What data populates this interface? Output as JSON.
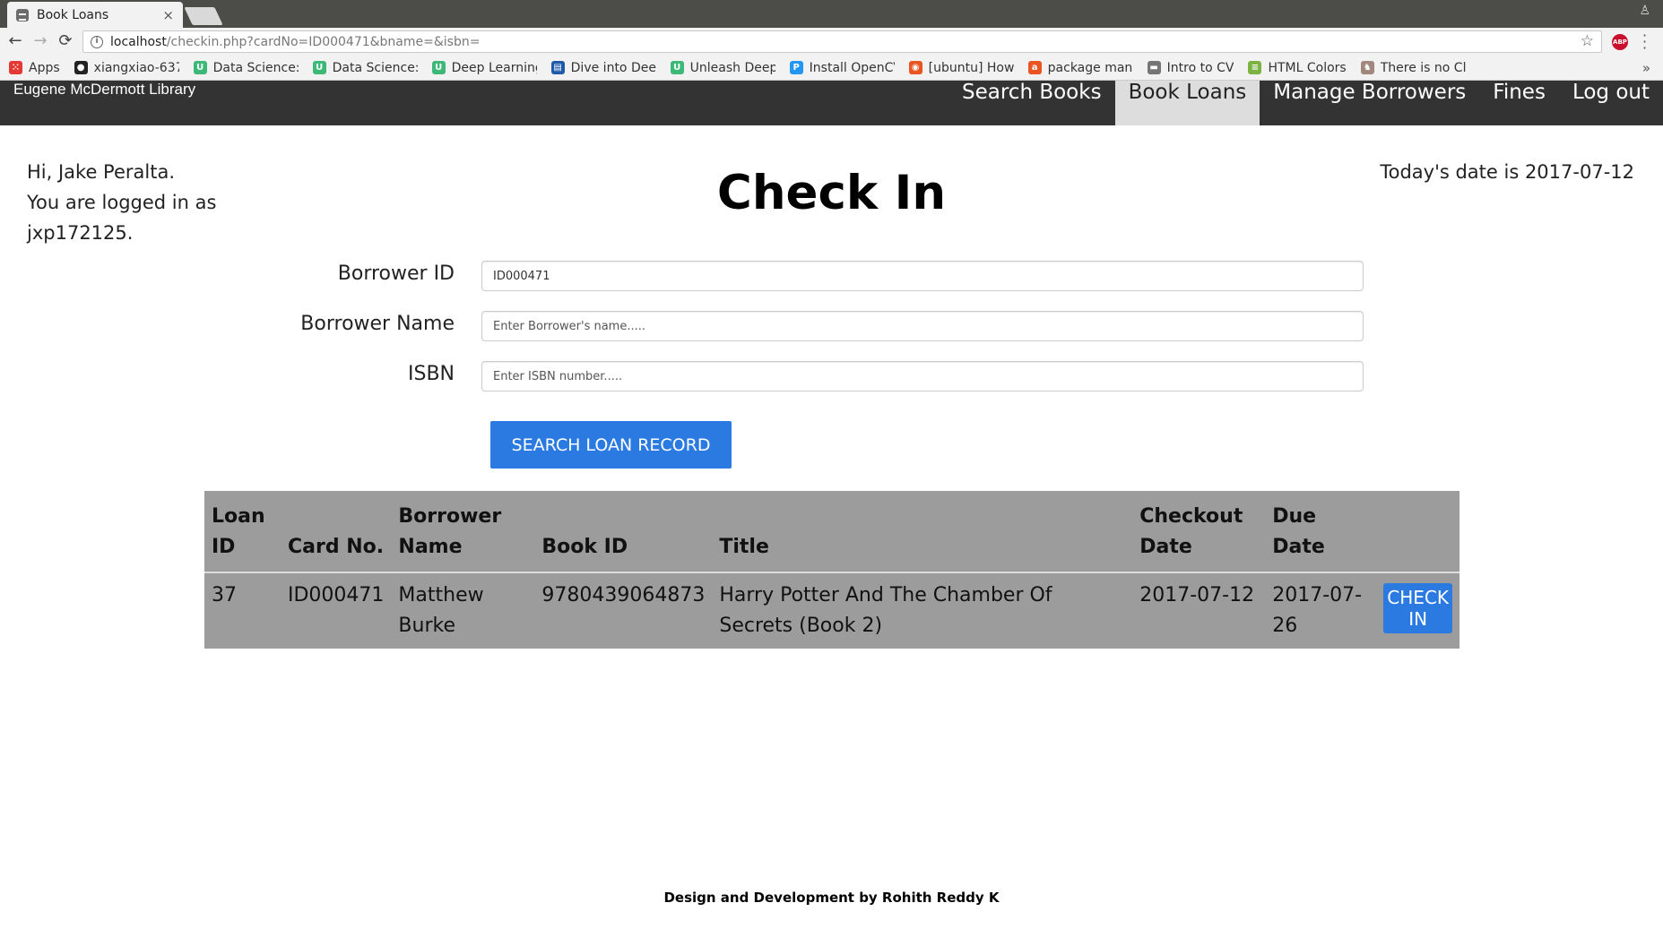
{
  "browser": {
    "tab_title": "Book Loans",
    "tab_close": "×",
    "url_host": "localhost",
    "url_path": "/checkin.php?cardNo=ID000471&bname=&isbn=",
    "back": "←",
    "forward": "→",
    "reload": "⟳",
    "star": "☆",
    "abp": "ABP",
    "more_bookmarks": "»",
    "bookmarks": [
      {
        "label": "Apps",
        "icon": "apps-grid-icon",
        "color": "#e53935"
      },
      {
        "label": "xiangxiao-6378-j",
        "icon": "github-icon",
        "color": "#222222"
      },
      {
        "label": "Data Science: De",
        "icon": "udacity-icon",
        "color": "#3cb878"
      },
      {
        "label": "Data Science: Pr",
        "icon": "udacity-icon",
        "color": "#3cb878"
      },
      {
        "label": "Deep Learning: C",
        "icon": "udacity-icon",
        "color": "#3cb878"
      },
      {
        "label": "Dive into Deep L",
        "icon": "book-icon",
        "color": "#1e5aa8"
      },
      {
        "label": "Unleash Deep Le",
        "icon": "udacity-icon",
        "color": "#3cb878"
      },
      {
        "label": "Install OpenCV 3",
        "icon": "p-icon",
        "color": "#2196f3"
      },
      {
        "label": "[ubuntu] How to",
        "icon": "ubuntu-icon",
        "color": "#e95420"
      },
      {
        "label": "package manage",
        "icon": "askubuntu-icon",
        "color": "#e95420"
      },
      {
        "label": "Intro to CV",
        "icon": "folder-icon",
        "color": "#757575"
      },
      {
        "label": "HTML Colors",
        "icon": "colors-icon",
        "color": "#7cb342"
      },
      {
        "label": "There is no Clou",
        "icon": "owl-icon",
        "color": "#a1887f"
      }
    ]
  },
  "nav": {
    "brand": "Eugene McDermott Library",
    "links": [
      "Search Books",
      "Book Loans",
      "Manage Borrowers",
      "Fines",
      "Log out"
    ],
    "active_index": 1
  },
  "page": {
    "greeting_line1": "Hi, Jake Peralta.",
    "greeting_line2": "You are logged in as",
    "greeting_line3": "jxp172125.",
    "today": "Today's date is 2017-07-12",
    "title": "Check In"
  },
  "form": {
    "borrower_id_label": "Borrower ID",
    "borrower_id_value": "ID000471",
    "borrower_name_label": "Borrower Name",
    "borrower_name_placeholder": "Enter Borrower's name.....",
    "isbn_label": "ISBN",
    "isbn_placeholder": "Enter ISBN number.....",
    "search_button": "SEARCH LOAN RECORD"
  },
  "table": {
    "headers": [
      "Loan ID",
      "Card No.",
      "Borrower Name",
      "Book ID",
      "Title",
      "Checkout Date",
      "Due Date",
      ""
    ],
    "rows": [
      {
        "loan_id": "37",
        "card_no": "ID000471",
        "borrower_name": "Matthew Burke",
        "book_id": "9780439064873",
        "title": "Harry Potter And The Chamber Of Secrets (Book 2)",
        "checkout_date": "2017-07-12",
        "due_date": "2017-07-26",
        "action": "CHECK IN"
      }
    ]
  },
  "footer": "Design and Development by Rohith Reddy K",
  "colors": {
    "navbar": "#333333",
    "active_nav": "#dddddd",
    "primary_button": "#2a7ae2",
    "table_bg": "#9c9c9c"
  }
}
